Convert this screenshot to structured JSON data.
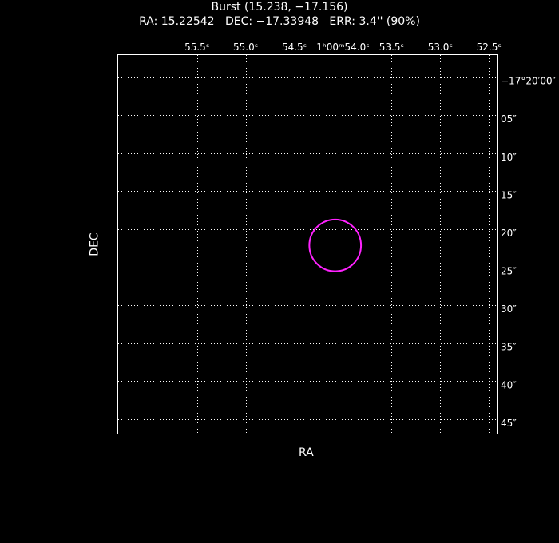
{
  "chart_data": {
    "type": "scatter",
    "title": "Burst (15.238, −17.156)",
    "subtitle": {
      "ra_label": "RA:",
      "ra_value": "15.22542",
      "dec_label": "DEC:",
      "dec_value": "−17.33948",
      "err_label": "ERR:",
      "err_value": "3.4'' (90%)"
    },
    "xlabel": "RA",
    "ylabel": "DEC",
    "x_ticks": [
      {
        "value": 55.5,
        "label": "55.5ˢ"
      },
      {
        "value": 55.0,
        "label": "55.0ˢ"
      },
      {
        "value": 54.5,
        "label": "54.5ˢ"
      },
      {
        "value": 54.0,
        "label": "1ʰ00ᵐ54.0ˢ"
      },
      {
        "value": 53.5,
        "label": "53.5ˢ"
      },
      {
        "value": 53.0,
        "label": "53.0ˢ"
      },
      {
        "value": 52.5,
        "label": "52.5ˢ"
      }
    ],
    "y_ticks": [
      {
        "value": 0,
        "label": "−17°20′00″"
      },
      {
        "value": 5,
        "label": "05″"
      },
      {
        "value": 10,
        "label": "10″"
      },
      {
        "value": 15,
        "label": "15″"
      },
      {
        "value": 20,
        "label": "20″"
      },
      {
        "value": 25,
        "label": "25″"
      },
      {
        "value": 30,
        "label": "30″"
      },
      {
        "value": 35,
        "label": "35″"
      },
      {
        "value": 40,
        "label": "40″"
      },
      {
        "value": 45,
        "label": "45″"
      }
    ],
    "xlim": [
      56.31,
      52.42
    ],
    "ylim": [
      -2.9,
      46.9
    ],
    "grid": true,
    "error_circle": {
      "ra_seconds": 54.08,
      "dec_arcsec": 22.13,
      "radius_arcsec": 3.4,
      "color": "#ff22ff"
    },
    "colors": {
      "background": "#000000",
      "foreground": "#ffffff",
      "circle": "#ff22ff"
    }
  }
}
